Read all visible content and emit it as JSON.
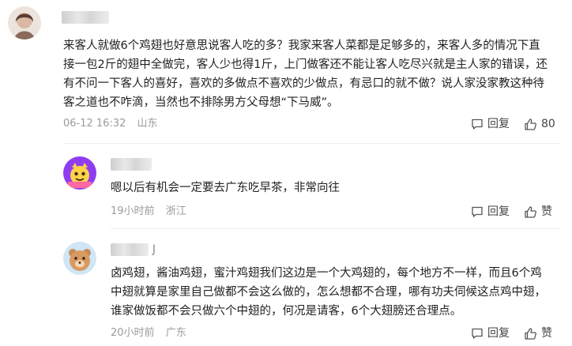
{
  "comments": [
    {
      "text_lines": [
        "来客人就做6个鸡翅也好意思说客人吃的多？我家来客人菜都是足够多的，来客人多的情况下直",
        "接一包2斤的翅中全做完，客人少也得1斤，上门做客还不能让客人吃尽兴就是主人家的错误，还",
        "有不问一下客人的喜好，喜欢的多做点不喜欢的少做点，有忌口的就不做？说人家没家教这种待",
        "客之道也不咋滴，当然也不排除男方父母想“下马威”。"
      ],
      "time": "06-12 16:32",
      "location": "山东",
      "reply_label": "回复",
      "like_label": "80"
    },
    {
      "text_lines": [
        "嗯以后有机会一定要去广东吃早茶，非常向往"
      ],
      "time": "19小时前",
      "location": "浙江",
      "reply_label": "回复",
      "like_label": "赞"
    },
    {
      "username_tail": "J",
      "text_lines": [
        "卤鸡翅，酱油鸡翅，蜜汁鸡翅我们这边是一个大鸡翅的，每个地方不一样，而且6个鸡",
        "中翅就算是家里自己做都不会这么做的，怎么想都不合理，哪有功夫伺候这点鸡中翅，",
        "谁家做饭都不会只做六个中翅的，何况是请客，6个大翅膀还合理点。"
      ],
      "time": "20小时前",
      "location": "广东",
      "reply_label": "回复",
      "like_label": "赞"
    }
  ],
  "icons": {
    "reply": "comment-bubble-icon",
    "like": "thumbs-up-icon"
  },
  "colors": {
    "text": "#222222",
    "meta": "#9b9b9b",
    "action": "#444444",
    "divider": "#eeeeee"
  }
}
